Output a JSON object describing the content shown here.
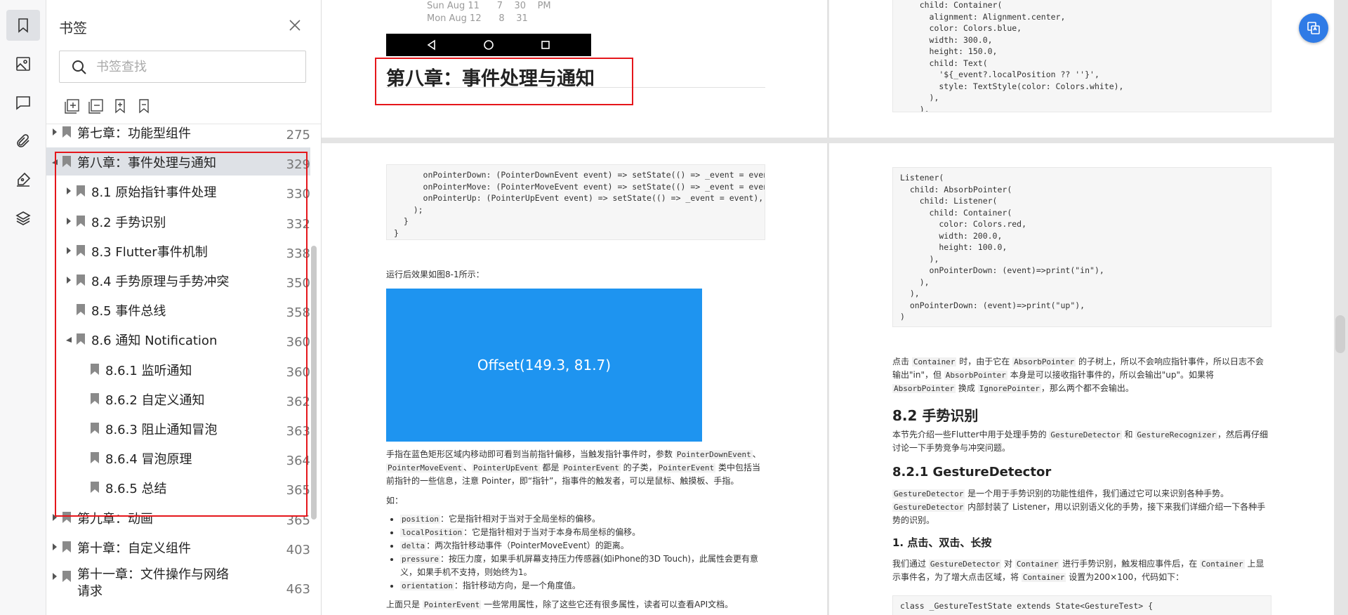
{
  "rail": {
    "items": [
      {
        "name": "bookmark-icon",
        "active": true
      },
      {
        "name": "image-icon",
        "active": false
      },
      {
        "name": "comment-icon",
        "active": false
      },
      {
        "name": "attachment-icon",
        "active": false
      },
      {
        "name": "signature-icon",
        "active": false
      },
      {
        "name": "layers-icon",
        "active": false
      }
    ]
  },
  "panel": {
    "title": "书签",
    "search_placeholder": "书签查找",
    "tools": [
      "expand-all-icon",
      "collapse-all-icon",
      "add-bookmark-icon",
      "remove-bookmark-icon"
    ]
  },
  "tree": [
    {
      "label": "第七章：功能型组件",
      "page": "275",
      "level": 0,
      "arrow": "right"
    },
    {
      "label": "第八章：事件处理与通知",
      "page": "329",
      "level": 0,
      "arrow": "down",
      "selected": true
    },
    {
      "label": "8.1 原始指针事件处理",
      "page": "330",
      "level": 1,
      "arrow": "right"
    },
    {
      "label": "8.2 手势识别",
      "page": "332",
      "level": 1,
      "arrow": "right"
    },
    {
      "label": "8.3 Flutter事件机制",
      "page": "338",
      "level": 1,
      "arrow": "right"
    },
    {
      "label": "8.4 手势原理与手势冲突",
      "page": "350",
      "level": 1,
      "arrow": "right"
    },
    {
      "label": "8.5 事件总线",
      "page": "358",
      "level": 1,
      "arrow": "none"
    },
    {
      "label": "8.6 通知 Notification",
      "page": "360",
      "level": 1,
      "arrow": "down"
    },
    {
      "label": "8.6.1 监听通知",
      "page": "360",
      "level": 2,
      "arrow": "none"
    },
    {
      "label": "8.6.2 自定义通知",
      "page": "362",
      "level": 2,
      "arrow": "none"
    },
    {
      "label": "8.6.3 阻止通知冒泡",
      "page": "363",
      "level": 2,
      "arrow": "none"
    },
    {
      "label": "8.6.4 冒泡原理",
      "page": "364",
      "level": 2,
      "arrow": "none"
    },
    {
      "label": "8.6.5 总结",
      "page": "365",
      "level": 2,
      "arrow": "none"
    },
    {
      "label": "第九章：动画",
      "page": "365",
      "level": 0,
      "arrow": "right"
    },
    {
      "label": "第十章：自定义组件",
      "page": "403",
      "level": 0,
      "arrow": "right"
    },
    {
      "label": "第十一章：文件操作与网络请求",
      "page": "463",
      "level": 0,
      "arrow": "right",
      "wrap": true
    }
  ],
  "doc": {
    "calendar_fragment": "Sun Aug 11      7    30    PM\nMon Aug 12      8    31",
    "chapter_heading": "第八章：事件处理与通知",
    "code_top_right": "    child: Container(\n      alignment: Alignment.center,\n      color: Colors.blue,\n      width: 300.0,\n      height: 150.0,\n      child: Text(\n        '${_event?.localPosition ?? ''}',\n        style: TextStyle(color: Colors.white),\n      ),\n    ),",
    "code_bot_left": "      onPointerDown: (PointerDownEvent event) => setState(() => _event = event),\n      onPointerMove: (PointerMoveEvent event) => setState(() => _event = event),\n      onPointerUp: (PointerUpEvent event) => setState(() => _event = event),\n    );\n  }\n}",
    "run_caption": "运行后效果如图8-1所示：",
    "demo_text": "Offset(149.3, 81.7)",
    "para1_a": "手指在蓝色矩形区域内移动即可看到当前指针偏移，当触发指针事件时，参数 ",
    "para1_b": "PointerDownEvent",
    "para1_c": "、",
    "para1_d": "PointerMoveEvent",
    "para1_e": "、",
    "para1_f": "PointerUpEvent",
    "para1_g": " 都是 ",
    "para1_h": "PointerEvent",
    "para1_i": " 的子类，",
    "para1_j": "PointerEvent",
    "para1_k": " 类中包括当前指针的一些信息，注意 Pointer，即“指针”，指事件的触发者，可以是鼠标、触摸板、手指。",
    "ru": "如：",
    "list": [
      {
        "code": "position",
        "text": "：它是指针相对于当对于全局坐标的偏移。"
      },
      {
        "code": "localPosition",
        "text": "：它是指针相对于当对于本身布局坐标的偏移。"
      },
      {
        "code": "delta",
        "text": "：两次指针移动事件（PointerMoveEvent）的距离。"
      },
      {
        "code": "pressure",
        "text": "：按压力度，如果手机屏幕支持压力传感器(如iPhone的3D Touch)，此属性会更有意义，如果手机不支持，则始终为1。"
      },
      {
        "code": "orientation",
        "text": "：指针移动方向，是一个角度值。"
      }
    ],
    "para_bottom_a": "上面只是 ",
    "para_bottom_b": "PointerEvent",
    "para_bottom_c": " 一些常用属性，除了这些它还有很多属性，读者可以查看API文档。",
    "code_bot_right": "Listener(\n  child: AbsorbPointer(\n    child: Listener(\n      child: Container(\n        color: Colors.red,\n        width: 200.0,\n        height: 100.0,\n      ),\n      onPointerDown: (event)=>print(\"in\"),\n    ),\n  ),\n  onPointerDown: (event)=>print(\"up\"),\n)",
    "para_r1_a": "点击 ",
    "para_r1_b": "Container",
    "para_r1_c": " 时，由于它在 ",
    "para_r1_d": "AbsorbPointer",
    "para_r1_e": " 的子树上，所以不会响应指针事件，所以日志不会输出\"in\"，但 ",
    "para_r1_f": "AbsorbPointer",
    "para_r1_g": " 本身是可以接收指针事件的，所以会输出\"up\"。如果将 ",
    "para_r1_h": "AbsorbPointer",
    "para_r1_i": " 换成 ",
    "para_r1_j": "IgnorePointer",
    "para_r1_k": "，那么两个都不会输出。",
    "h_82": "8.2 手势识别",
    "para_r2_a": "本节先介绍一些Flutter中用于处理手势的 ",
    "para_r2_b": "GestureDetector",
    "para_r2_c": " 和 ",
    "para_r2_d": "GestureRecognizer",
    "para_r2_e": "，然后再仔细讨论一下手势竞争与冲突问题。",
    "h_821": "8.2.1 GestureDetector",
    "para_r3_a": "GestureDetector",
    "para_r3_b": " 是一个用于手势识别的功能性组件，我们通过它可以来识别各种手势。",
    "para_r3_c": "GestureDetector",
    "para_r3_d": " 内部封装了 Listener，用以识别语义化的手势，接下来我们详细介绍一下各种手势的识别。",
    "h_1": "1. 点击、双击、长按",
    "para_r4_a": "我们通过 ",
    "para_r4_b": "GestureDetector",
    "para_r4_c": " 对 ",
    "para_r4_d": "Container",
    "para_r4_e": " 进行手势识别，触发相应事件后，在 ",
    "para_r4_f": "Container",
    "para_r4_g": " 上显示事件名，为了增大点击区域，将 ",
    "para_r4_h": "Container",
    "para_r4_i": " 设置为200×100，代码如下：",
    "code_last": "class _GestureTestState extends State<GestureTest> {"
  },
  "colors": {
    "highlight": "#e5161b",
    "demo_blue": "#1e94f0",
    "fab_blue": "#2f7be6"
  }
}
